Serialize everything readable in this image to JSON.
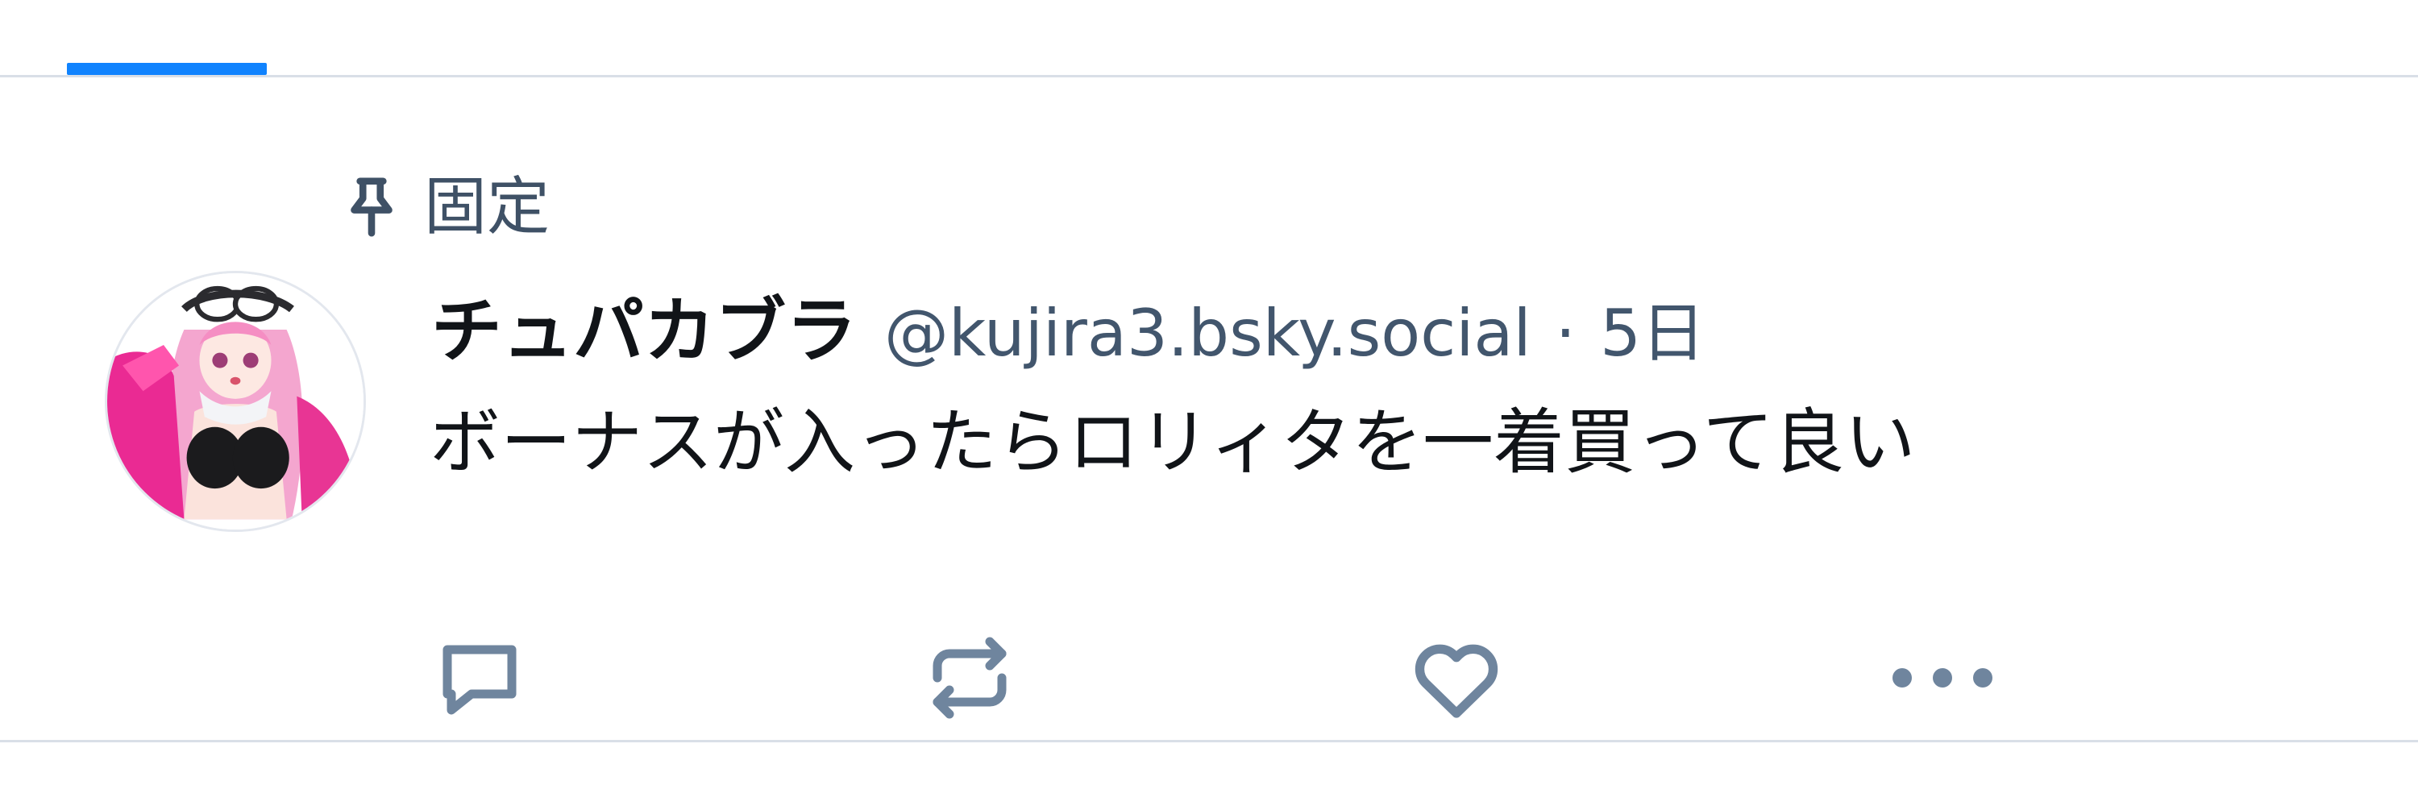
{
  "tabs": {
    "active_indicator_color": "#1083fe"
  },
  "post": {
    "pinned_label": "固定",
    "author": {
      "display_name": "チュパカブラ",
      "handle": "@kujira3.bsky.social",
      "avatar": "avatar-image"
    },
    "separator": "·",
    "time": "5日",
    "text": "ボーナスが入ったらロリィタを一着買って良い",
    "icons": {
      "pinned": "pin-icon",
      "reply": "reply-icon",
      "repost": "repost-icon",
      "like": "heart-icon",
      "more": "more-options-icon"
    },
    "colors": {
      "icon": "#6f859e",
      "secondary_text": "#42566d",
      "primary_text": "#111418"
    }
  }
}
